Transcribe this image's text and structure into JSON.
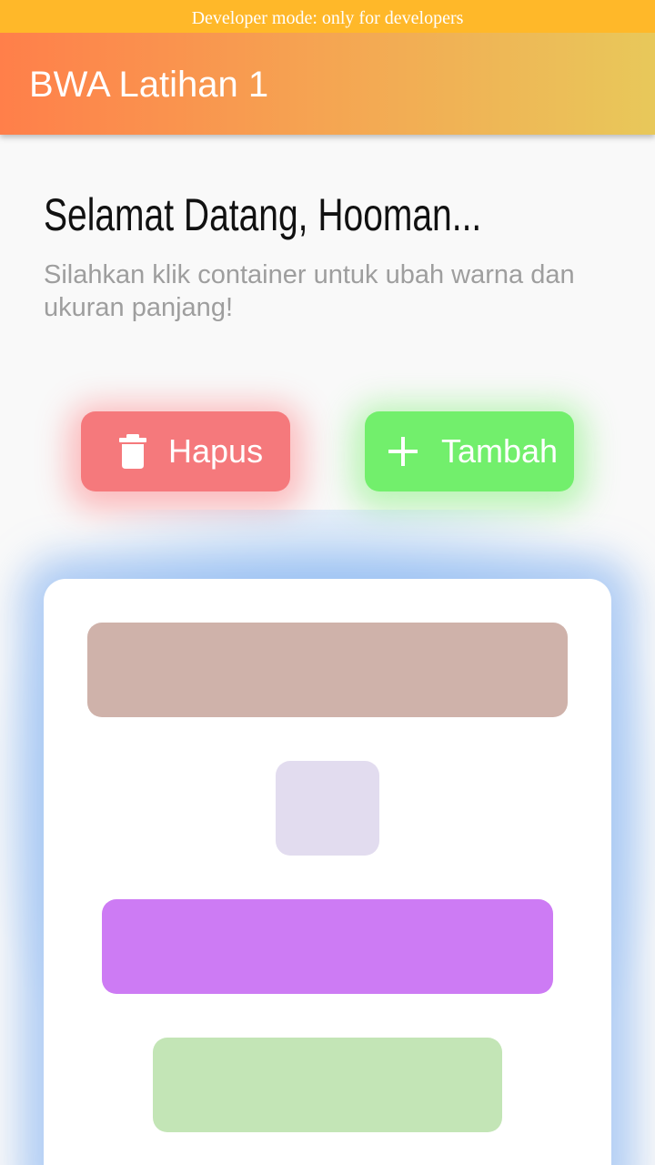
{
  "banner": {
    "text": "Developer mode: only for developers"
  },
  "app_bar": {
    "title": "BWA Latihan 1",
    "gradient_start": "#ff7f4a",
    "gradient_end": "#e8c85a"
  },
  "content": {
    "greeting": "Selamat Datang, Hooman...",
    "subtitle": "Silahkan klik container untuk ubah warna dan ukuran panjang!"
  },
  "buttons": {
    "delete": {
      "label": "Hapus",
      "icon": "trash-icon",
      "color": "#f5797c"
    },
    "add": {
      "label": "Tambah",
      "icon": "plus-icon",
      "color": "#72ef6c"
    }
  },
  "tiles": [
    {
      "color": "#cfb2aa"
    },
    {
      "color": "#e2dcef"
    },
    {
      "color": "#cd7bf4"
    },
    {
      "color": "#c3e5b6"
    }
  ]
}
